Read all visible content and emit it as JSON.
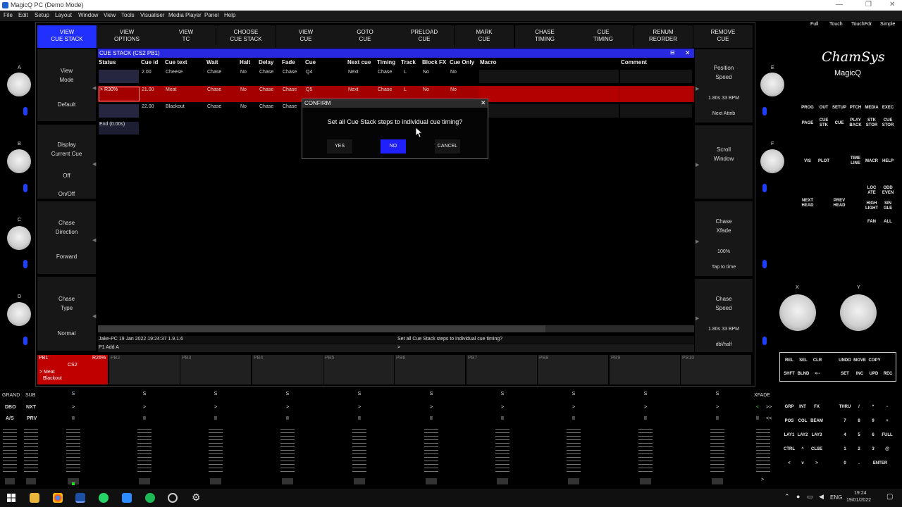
{
  "window": {
    "title": "MagicQ PC (Demo Mode)"
  },
  "menu": [
    "File",
    "Edit",
    "Setup",
    "Layout",
    "Window",
    "View",
    "Tools",
    "Visualiser",
    "Media Player",
    "Panel",
    "Help"
  ],
  "softkeys": [
    {
      "label": "VIEW\nCUE STACK",
      "active": true
    },
    {
      "label": "VIEW\nOPTIONS"
    },
    {
      "label": "VIEW\nTC"
    },
    {
      "label": "CHOOSE\nCUE STACK"
    },
    {
      "label": "VIEW\nCUE"
    },
    {
      "label": "GOTO\nCUE"
    },
    {
      "label": "PRELOAD\nCUE"
    },
    {
      "label": "MARK\nCUE"
    },
    {
      "label": "CHASE\nTIMING"
    },
    {
      "label": "CUE\nTIMING"
    },
    {
      "label": "RENUM\nREORDER"
    },
    {
      "label": "REMOVE\nCUE"
    }
  ],
  "left_panels": [
    {
      "main": "View\nMode",
      "value": "Default"
    },
    {
      "main": "Display\nCurrent Cue",
      "value": "Off\n\nOn/Off"
    },
    {
      "main": "Chase\nDirection",
      "value": "Forward"
    },
    {
      "main": "Chase\nType",
      "value": "Normal"
    }
  ],
  "right_panels": [
    {
      "main": "Position\nSpeed",
      "value": "1.80s    33 BPM\n\nNext Attrib"
    },
    {
      "main": "Scroll\nWindow",
      "value": ""
    },
    {
      "main": "Chase\nXfade",
      "value": "100%\n\nTap to time"
    },
    {
      "main": "Chase\nSpeed",
      "value": "1.80s    33 BPM\n\ndbl/half"
    }
  ],
  "encoder_labels": [
    "A",
    "B",
    "C",
    "D",
    "E",
    "F",
    "X",
    "Y"
  ],
  "cue_stack": {
    "title": "CUE STACK (CS2 PB1)",
    "columns": [
      "Status",
      "Cue id",
      "Cue text",
      "Wait",
      "Halt",
      "Delay",
      "Fade",
      "Cue",
      "Next cue",
      "Timing",
      "Track",
      "Block FX",
      "Cue Only",
      "Macro",
      "Comment"
    ],
    "rows": [
      [
        "",
        "2.00",
        "Cheese",
        "Chase",
        "No",
        "Chase",
        "Chase",
        "Q4",
        "Next",
        "Chase",
        "L",
        "No",
        "No",
        "",
        ""
      ],
      [
        "> R30%",
        "21.00",
        "Meat",
        "Chase",
        "No",
        "Chase",
        "Chase",
        "Q5",
        "Next",
        "Chase",
        "L",
        "No",
        "No",
        "",
        ""
      ],
      [
        "",
        "22.00",
        "Blackout",
        "Chase",
        "No",
        "Chase",
        "Chase",
        "",
        "",
        "",
        "",
        "",
        "",
        "",
        ""
      ]
    ],
    "end_label": "End (0.00s)"
  },
  "status": {
    "left": "Jake-PC 19 Jan 2022 19:24:37 1.9.1.6",
    "right": "Set all Cue Stack steps to individual cue timing?",
    "cmd_left": "P1 Add A",
    "cmd_right": ">"
  },
  "dialog": {
    "title": "CONFIRM",
    "message": "Set all Cue Stack steps to individual cue timing?",
    "yes": "YES",
    "no": "NO",
    "cancel": "CANCEL"
  },
  "playbacks": [
    {
      "label": "PB1",
      "level": "R26%",
      "stack": "CS2",
      "cue": "> Meat",
      "next": "Blackout"
    },
    {
      "label": "PB2"
    },
    {
      "label": "PB3"
    },
    {
      "label": "PB4"
    },
    {
      "label": "PB5"
    },
    {
      "label": "PB6"
    },
    {
      "label": "PB7"
    },
    {
      "label": "PB8"
    },
    {
      "label": "PB9"
    },
    {
      "label": "PB10"
    }
  ],
  "logo": {
    "brand": "ChamSys",
    "product": "MagicQ"
  },
  "view_modes": [
    "Full",
    "Touch",
    "TouchFdr",
    "Simple"
  ],
  "keys_main": [
    [
      "PROG",
      "OUT",
      "SETUP",
      "PTCH",
      "MEDIA",
      "EXEC"
    ],
    [
      "PAGE",
      "CUE\nSTK",
      "CUE",
      "PLAY\nBACK",
      "STK\nSTOR",
      "CUE\nSTOR"
    ]
  ],
  "keys_row3": [
    "VIS",
    "PLOT",
    "TIME\nLINE",
    "MACR",
    "HELP"
  ],
  "keys_extra": [
    "LOC\nATE",
    "ODD\nEVEN",
    "NEXT\nHEAD",
    "PREV\nHEAD",
    "HIGH\nLIGHT",
    "SIN\nGLE",
    "FAN",
    "ALL"
  ],
  "keys_edit": [
    "REL",
    "SEL",
    "CLR",
    "UNDO",
    "MOVE",
    "COPY",
    "SHFT",
    "BLND",
    "<--",
    "SET",
    "INC",
    "UPD",
    "REC"
  ],
  "keypad": [
    [
      "GRP",
      "INT",
      "FX",
      "THRU",
      "/",
      "*",
      "-"
    ],
    [
      "POS",
      "COL",
      "BEAM",
      "7",
      "8",
      "9",
      "+"
    ],
    [
      "LAY1",
      "LAY2",
      "LAY3",
      "4",
      "5",
      "6",
      "FULL"
    ],
    [
      "CTRL",
      "^",
      "CLSE",
      "1",
      "2",
      "3",
      "@"
    ],
    [
      "<",
      "v",
      ">",
      "0",
      ".",
      "ENTER"
    ]
  ],
  "fader_section": {
    "grand": "GRAND",
    "sub": "SUB",
    "left_buttons": [
      "DBO",
      "NXT",
      "A/S",
      "PRV"
    ],
    "xfade": "XFADE",
    "xfade_buttons": [
      "<",
      ">>",
      "II",
      "<<"
    ],
    "fader_buttons": [
      "S",
      ">",
      "II"
    ]
  },
  "taskbar": {
    "time": "19:24",
    "date": "19/01/2022",
    "lang": "ENG"
  }
}
